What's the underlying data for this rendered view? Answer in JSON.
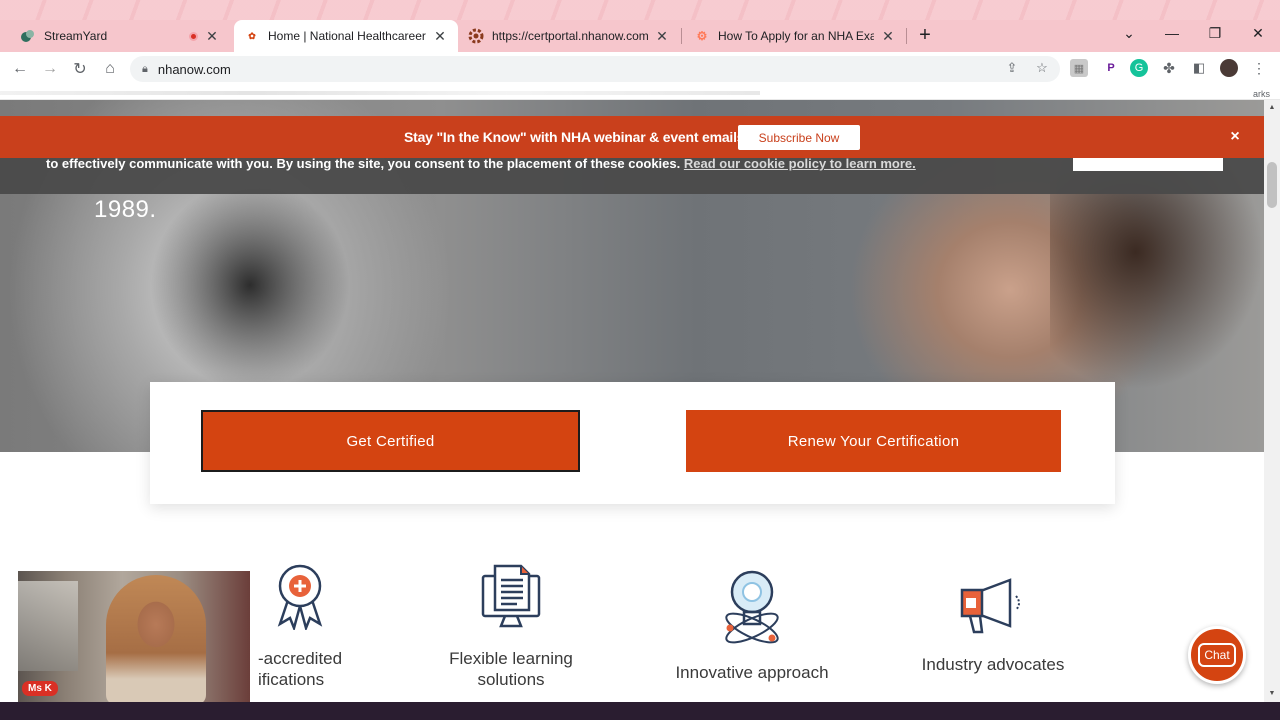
{
  "browser": {
    "tabs": [
      {
        "title": "StreamYard",
        "recording": true
      },
      {
        "title": "Home | National Healthcareer Ass"
      },
      {
        "title": "https://certportal.nhanow.com/u"
      },
      {
        "title": "How To Apply for an NHA Exam"
      }
    ],
    "address": "nhanow.com",
    "bookmarks_more": "arks"
  },
  "page": {
    "promo_banner": {
      "message": "Stay \"In the Know\" with NHA webinar & event emails.",
      "subscribe_label": "Subscribe Now",
      "close_label": "×"
    },
    "cookie_notice": {
      "text": "to effectively communicate with you. By using the site, you consent to the placement of these cookies.",
      "link_text": "Read our cookie policy to learn more."
    },
    "hero": {
      "year_text": "1989."
    },
    "cta": {
      "primary_label": "Get Certified",
      "secondary_label": "Renew Your Certification"
    },
    "features": [
      {
        "line1": "-accredited",
        "line2": "ifications",
        "icon": "award-ribbon-icon"
      },
      {
        "line1": "Flexible learning",
        "line2": "solutions",
        "icon": "document-monitor-icon"
      },
      {
        "line1": "Innovative approach",
        "line2": "",
        "icon": "lightbulb-atom-icon"
      },
      {
        "line1": "Industry advocates",
        "line2": "",
        "icon": "megaphone-icon"
      }
    ],
    "chat_label": "Chat"
  },
  "overlay": {
    "webcam_name": "Ms K"
  },
  "colors": {
    "brand_orange": "#d44411",
    "promo_red": "#c9401c",
    "icon_navy": "#2c3e5c"
  }
}
